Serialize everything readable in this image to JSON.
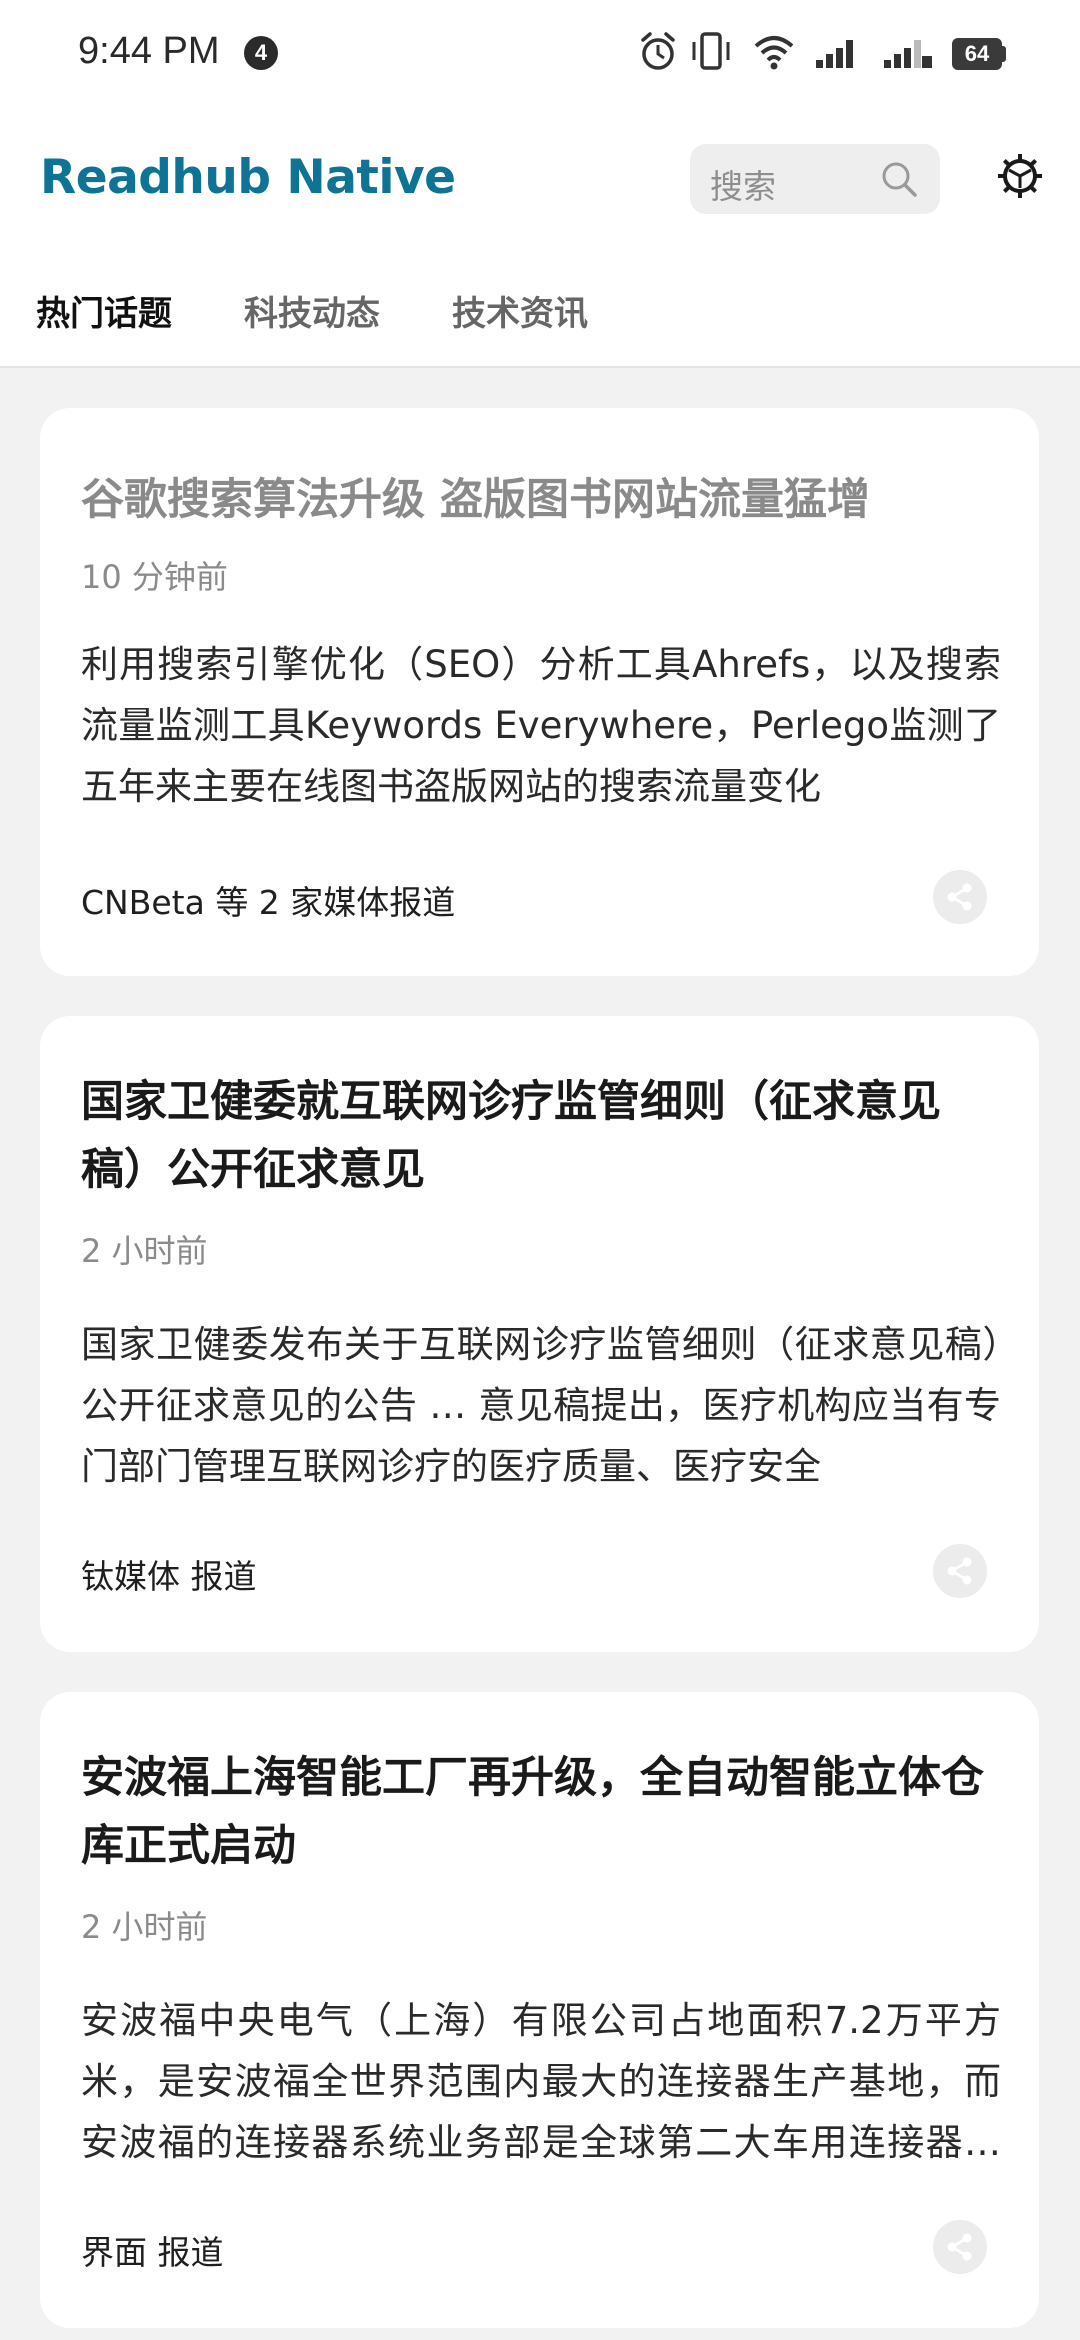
{
  "status_bar": {
    "time": "9:44 PM",
    "notification_count": "4",
    "battery": "64"
  },
  "header": {
    "app_title": "Readhub Native",
    "search_placeholder": "搜索"
  },
  "tabs": [
    {
      "label": "热门话题",
      "active": true
    },
    {
      "label": "科技动态",
      "active": false
    },
    {
      "label": "技术资讯",
      "active": false
    }
  ],
  "cards": [
    {
      "title": "谷歌搜索算法升级 盗版图书网站流量猛增",
      "time": "10 分钟前",
      "summary": "利用搜索引擎优化（SEO）分析工具Ahrefs，以及搜索流量监测工具Keywords Everywhere，Perlego监测了五年来主要在线图书盗版网站的搜索流量变化",
      "source": "CNBeta 等 2 家媒体报道"
    },
    {
      "title": "国家卫健委就互联网诊疗监管细则（征求意见稿）公开征求意见",
      "time": "2 小时前",
      "summary": "国家卫健委发布关于互联网诊疗监管细则（征求意见稿）公开征求意见的公告 … 意见稿提出，医疗机构应当有专门部门管理互联网诊疗的医疗质量、医疗安全",
      "source": "钛媒体 报道"
    },
    {
      "title": "安波福上海智能工厂再升级，全自动智能立体仓库正式启动",
      "time": "2 小时前",
      "summary": "安波福中央电气（上海）有限公司占地面积7.2万平方米，是安波福全世界范围内最大的连接器生产基地，而安波福的连接器系统业务部是全球第二大车用连接器供应商",
      "source": "界面 报道"
    }
  ],
  "colors": {
    "brand": "#0e7394",
    "background": "#f2f2f2",
    "card": "#ffffff"
  }
}
